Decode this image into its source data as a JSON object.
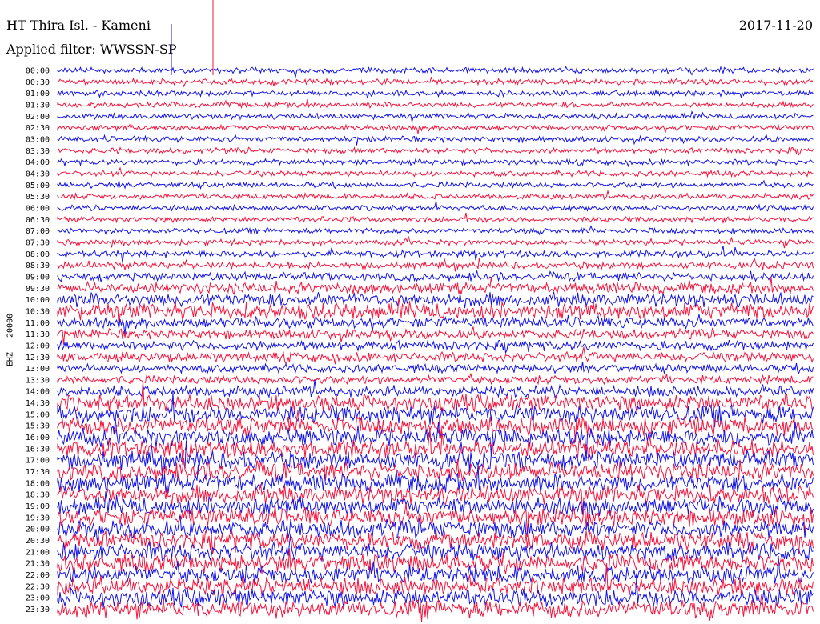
{
  "header": {
    "station": "HT Thira Isl. - Kameni",
    "filter": "Applied filter: WWSSN-SP",
    "date": "2017-11-20"
  },
  "chart_data": {
    "type": "line",
    "title": "HT Thira Isl. - Kameni",
    "subtitle": "Applied filter: WWSSN-SP",
    "ylabel": "EHZ - 20000",
    "xlabel": "",
    "date": "2017-11-20",
    "row_labels": [
      "00:00",
      "00:30",
      "01:00",
      "01:30",
      "02:00",
      "02:30",
      "03:00",
      "03:30",
      "04:00",
      "04:30",
      "05:00",
      "05:30",
      "06:00",
      "06:30",
      "07:00",
      "07:30",
      "08:00",
      "08:30",
      "09:00",
      "09:30",
      "10:00",
      "10:30",
      "11:00",
      "11:30",
      "12:00",
      "12:30",
      "13:00",
      "13:30",
      "14:00",
      "14:30",
      "15:00",
      "15:30",
      "16:00",
      "16:30",
      "17:00",
      "17:30",
      "18:00",
      "18:30",
      "19:00",
      "19:30",
      "20:00",
      "20:30",
      "21:00",
      "21:30",
      "22:00",
      "22:30",
      "23:00",
      "23:30"
    ],
    "row_amplitude": [
      4,
      4,
      4,
      4,
      4,
      4,
      4,
      4,
      4,
      4,
      4,
      4,
      4,
      4,
      4,
      4,
      5,
      5,
      6,
      8,
      10,
      12,
      8,
      7,
      7,
      7,
      6,
      6,
      8,
      12,
      13,
      13,
      13,
      13,
      13,
      13,
      13,
      13,
      13,
      13,
      13,
      13,
      13,
      13,
      13,
      13,
      13,
      13
    ],
    "series_colors": [
      "#1414e6",
      "#f5143c"
    ],
    "grid": false
  }
}
